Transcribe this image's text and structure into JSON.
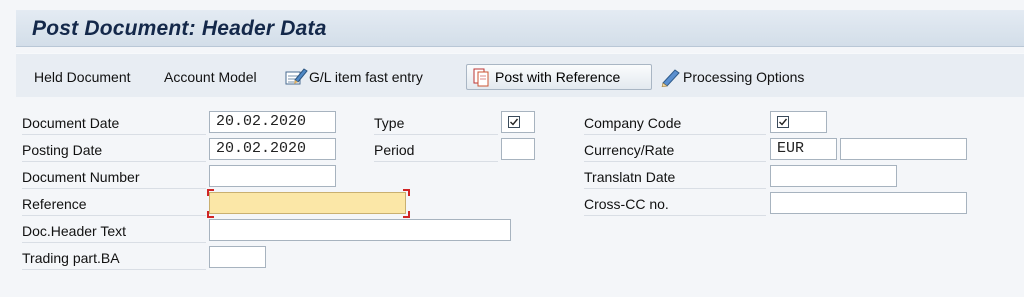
{
  "window": {
    "title": "Post Document: Header Data"
  },
  "toolbar": {
    "held_document": "Held Document",
    "account_model": "Account Model",
    "gl_fast_entry": "G/L item fast entry",
    "post_with_reference": "Post with Reference",
    "processing_options": "Processing Options"
  },
  "form": {
    "document_date": {
      "label": "Document Date",
      "value": "20.02.2020"
    },
    "posting_date": {
      "label": "Posting Date",
      "value": "20.02.2020"
    },
    "document_number": {
      "label": "Document Number",
      "value": ""
    },
    "reference": {
      "label": "Reference",
      "value": ""
    },
    "doc_header_text": {
      "label": "Doc.Header Text",
      "value": ""
    },
    "trading_part_ba": {
      "label": "Trading part.BA",
      "value": ""
    },
    "type": {
      "label": "Type",
      "value": ""
    },
    "period": {
      "label": "Period",
      "value": ""
    },
    "company_code": {
      "label": "Company Code",
      "value": ""
    },
    "currency_rate": {
      "label": "Currency/Rate",
      "currency": "EUR",
      "rate": ""
    },
    "translatn_date": {
      "label": "Translatn Date",
      "value": ""
    },
    "cross_cc_no": {
      "label": "Cross-CC no.",
      "value": ""
    }
  },
  "icons": [
    "gl-fast-entry-icon",
    "post-with-reference-icon",
    "pencil-icon",
    "checkbox-icon"
  ],
  "colors": {
    "active_field": "#fbe7a7",
    "focus_corner": "#d02525",
    "title": "#14284a"
  }
}
